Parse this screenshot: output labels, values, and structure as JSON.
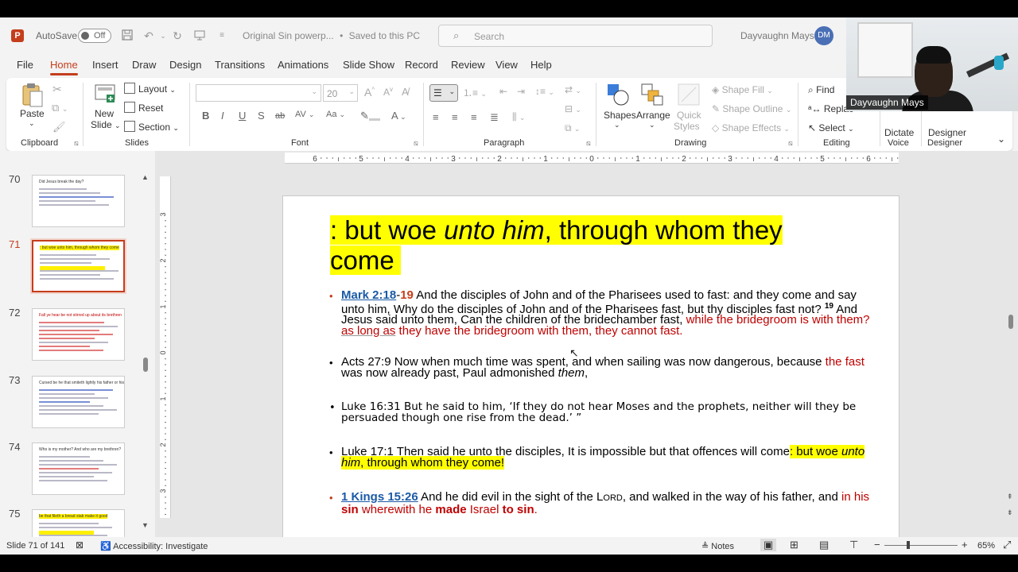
{
  "titlebar": {
    "app_logo": "P",
    "autosave_label": "AutoSave",
    "autosave_state": "Off",
    "doc_title": "Original Sin powerp...",
    "save_status": "Saved to this PC",
    "search_placeholder": "Search",
    "user_name": "Dayvaughn Mays",
    "user_initials": "DM"
  },
  "webcam": {
    "label": "Dayvaughn Mays"
  },
  "tabs": [
    "File",
    "Home",
    "Insert",
    "Draw",
    "Design",
    "Transitions",
    "Animations",
    "Slide Show",
    "Record",
    "Review",
    "View",
    "Help"
  ],
  "active_tab": "Home",
  "ribbon": {
    "clipboard": {
      "paste": "Paste",
      "label": "Clipboard"
    },
    "slides": {
      "new_slide_1": "New",
      "new_slide_2": "Slide",
      "layout": "Layout",
      "reset": "Reset",
      "section": "Section",
      "label": "Slides"
    },
    "font": {
      "font_size": "20",
      "label": "Font",
      "bold": "B",
      "italic": "I",
      "underline": "U",
      "strike": "S",
      "shadow": "ab"
    },
    "paragraph": {
      "label": "Paragraph"
    },
    "drawing": {
      "shapes": "Shapes",
      "arrange": "Arrange",
      "quick_styles_1": "Quick",
      "quick_styles_2": "Styles",
      "shape_fill": "Shape Fill",
      "shape_outline": "Shape Outline",
      "shape_effects": "Shape Effects",
      "label": "Drawing"
    },
    "editing": {
      "find": "Find",
      "replace": "Replac",
      "select": "Select",
      "label": "Editing"
    },
    "voice": {
      "dictate": "Dictate",
      "label": "Voice"
    },
    "designer": {
      "designer": "Designer",
      "label": "Designer"
    }
  },
  "thumbnails": [
    {
      "num": "70",
      "title": "Did Jesus break the day?"
    },
    {
      "num": "71",
      "title": ": but woe unto him, through whom they come"
    },
    {
      "num": "72",
      "title": "Fall ye hear be not stirred up about its brethren"
    },
    {
      "num": "73",
      "title": "Cursed be he that smiteth lightly his father or his mother"
    },
    {
      "num": "74",
      "title": "Who is my mother? And who are my brethren?"
    },
    {
      "num": "75",
      "title": "be that fileth a bread stab make it good"
    }
  ],
  "active_slide": "71",
  "ruler": {
    "h_ticks": [
      "6",
      "5",
      "4",
      "3",
      "2",
      "1",
      "0",
      "1",
      "2",
      "3",
      "4",
      "5",
      "6"
    ],
    "v_ticks": [
      "3",
      "2",
      "1",
      "0",
      "1",
      "2",
      "3"
    ]
  },
  "slide": {
    "title_a": ": but woe ",
    "title_b": "unto him",
    "title_c": ", through whom they come",
    "b1": {
      "ref": "Mark 2:18",
      "dash": "-",
      "ref2": "19",
      "text1": " And the disciples of John and of the Pharisees used to fast: and they come and say unto him, Why do the disciples of John and of the Pharisees fast, but thy disciples fast not? ",
      "sup": "19",
      "text2": " And Jesus said unto them, Can the children of the bridechamber fast, ",
      "red1": "while the bridegroom is with them? ",
      "red2": "as long as",
      "red3": " they have the bridegroom with them, they cannot fast",
      "end": "."
    },
    "b2": {
      "text1": "Acts 27:9 Now when much time was spent, and when sailing was now dangerous, because ",
      "red1": "the fast",
      "text2": " was now already past, Paul admonished ",
      "ital": "them",
      "end": ","
    },
    "b3": {
      "text": "Luke 16:31 But he said to him, ‘If they do not hear Moses and the prophets, neither will they be persuaded though one rise from the dead.’ ”"
    },
    "b4": {
      "text1": "Luke 17:1 Then said he unto the disciples, It is impossible but that offences will come",
      "hl1": ": but woe ",
      "hl_ital": "unto him",
      "hl2": ", through whom they come!"
    },
    "b5": {
      "ref": "1 Kings 15:26",
      "text1": " And he did evil in the sight of the L",
      "small": "ORD",
      "text2": ", and walked in the way of his father, and ",
      "r1": "in his ",
      "r2": "sin",
      "r3": " wherewith he ",
      "r4": "made",
      "r5": " Israel ",
      "r6": "to sin",
      "end": "."
    }
  },
  "status": {
    "slide_info": "Slide 71 of 141",
    "accessibility": "Accessibility: Investigate",
    "notes": "Notes",
    "zoom": "65%"
  },
  "colors": {
    "accent": "#c43e1c",
    "highlight": "#ffff00",
    "scripture_red": "#c00000",
    "link_blue": "#1b5aa6"
  }
}
